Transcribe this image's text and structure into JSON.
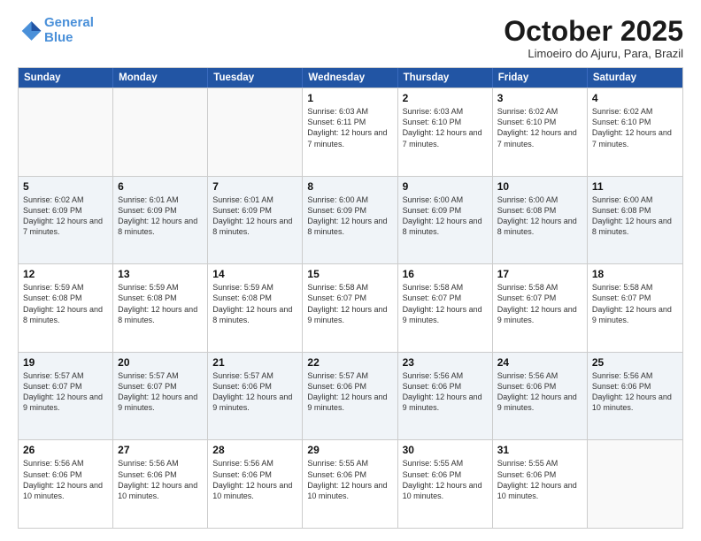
{
  "header": {
    "logo_line1": "General",
    "logo_line2": "Blue",
    "month": "October 2025",
    "location": "Limoeiro do Ajuru, Para, Brazil"
  },
  "weekdays": [
    "Sunday",
    "Monday",
    "Tuesday",
    "Wednesday",
    "Thursday",
    "Friday",
    "Saturday"
  ],
  "weeks": [
    [
      {
        "day": "",
        "text": ""
      },
      {
        "day": "",
        "text": ""
      },
      {
        "day": "",
        "text": ""
      },
      {
        "day": "1",
        "text": "Sunrise: 6:03 AM\nSunset: 6:11 PM\nDaylight: 12 hours and 7 minutes."
      },
      {
        "day": "2",
        "text": "Sunrise: 6:03 AM\nSunset: 6:10 PM\nDaylight: 12 hours and 7 minutes."
      },
      {
        "day": "3",
        "text": "Sunrise: 6:02 AM\nSunset: 6:10 PM\nDaylight: 12 hours and 7 minutes."
      },
      {
        "day": "4",
        "text": "Sunrise: 6:02 AM\nSunset: 6:10 PM\nDaylight: 12 hours and 7 minutes."
      }
    ],
    [
      {
        "day": "5",
        "text": "Sunrise: 6:02 AM\nSunset: 6:09 PM\nDaylight: 12 hours and 7 minutes."
      },
      {
        "day": "6",
        "text": "Sunrise: 6:01 AM\nSunset: 6:09 PM\nDaylight: 12 hours and 8 minutes."
      },
      {
        "day": "7",
        "text": "Sunrise: 6:01 AM\nSunset: 6:09 PM\nDaylight: 12 hours and 8 minutes."
      },
      {
        "day": "8",
        "text": "Sunrise: 6:00 AM\nSunset: 6:09 PM\nDaylight: 12 hours and 8 minutes."
      },
      {
        "day": "9",
        "text": "Sunrise: 6:00 AM\nSunset: 6:09 PM\nDaylight: 12 hours and 8 minutes."
      },
      {
        "day": "10",
        "text": "Sunrise: 6:00 AM\nSunset: 6:08 PM\nDaylight: 12 hours and 8 minutes."
      },
      {
        "day": "11",
        "text": "Sunrise: 6:00 AM\nSunset: 6:08 PM\nDaylight: 12 hours and 8 minutes."
      }
    ],
    [
      {
        "day": "12",
        "text": "Sunrise: 5:59 AM\nSunset: 6:08 PM\nDaylight: 12 hours and 8 minutes."
      },
      {
        "day": "13",
        "text": "Sunrise: 5:59 AM\nSunset: 6:08 PM\nDaylight: 12 hours and 8 minutes."
      },
      {
        "day": "14",
        "text": "Sunrise: 5:59 AM\nSunset: 6:08 PM\nDaylight: 12 hours and 8 minutes."
      },
      {
        "day": "15",
        "text": "Sunrise: 5:58 AM\nSunset: 6:07 PM\nDaylight: 12 hours and 9 minutes."
      },
      {
        "day": "16",
        "text": "Sunrise: 5:58 AM\nSunset: 6:07 PM\nDaylight: 12 hours and 9 minutes."
      },
      {
        "day": "17",
        "text": "Sunrise: 5:58 AM\nSunset: 6:07 PM\nDaylight: 12 hours and 9 minutes."
      },
      {
        "day": "18",
        "text": "Sunrise: 5:58 AM\nSunset: 6:07 PM\nDaylight: 12 hours and 9 minutes."
      }
    ],
    [
      {
        "day": "19",
        "text": "Sunrise: 5:57 AM\nSunset: 6:07 PM\nDaylight: 12 hours and 9 minutes."
      },
      {
        "day": "20",
        "text": "Sunrise: 5:57 AM\nSunset: 6:07 PM\nDaylight: 12 hours and 9 minutes."
      },
      {
        "day": "21",
        "text": "Sunrise: 5:57 AM\nSunset: 6:06 PM\nDaylight: 12 hours and 9 minutes."
      },
      {
        "day": "22",
        "text": "Sunrise: 5:57 AM\nSunset: 6:06 PM\nDaylight: 12 hours and 9 minutes."
      },
      {
        "day": "23",
        "text": "Sunrise: 5:56 AM\nSunset: 6:06 PM\nDaylight: 12 hours and 9 minutes."
      },
      {
        "day": "24",
        "text": "Sunrise: 5:56 AM\nSunset: 6:06 PM\nDaylight: 12 hours and 9 minutes."
      },
      {
        "day": "25",
        "text": "Sunrise: 5:56 AM\nSunset: 6:06 PM\nDaylight: 12 hours and 10 minutes."
      }
    ],
    [
      {
        "day": "26",
        "text": "Sunrise: 5:56 AM\nSunset: 6:06 PM\nDaylight: 12 hours and 10 minutes."
      },
      {
        "day": "27",
        "text": "Sunrise: 5:56 AM\nSunset: 6:06 PM\nDaylight: 12 hours and 10 minutes."
      },
      {
        "day": "28",
        "text": "Sunrise: 5:56 AM\nSunset: 6:06 PM\nDaylight: 12 hours and 10 minutes."
      },
      {
        "day": "29",
        "text": "Sunrise: 5:55 AM\nSunset: 6:06 PM\nDaylight: 12 hours and 10 minutes."
      },
      {
        "day": "30",
        "text": "Sunrise: 5:55 AM\nSunset: 6:06 PM\nDaylight: 12 hours and 10 minutes."
      },
      {
        "day": "31",
        "text": "Sunrise: 5:55 AM\nSunset: 6:06 PM\nDaylight: 12 hours and 10 minutes."
      },
      {
        "day": "",
        "text": ""
      }
    ]
  ]
}
